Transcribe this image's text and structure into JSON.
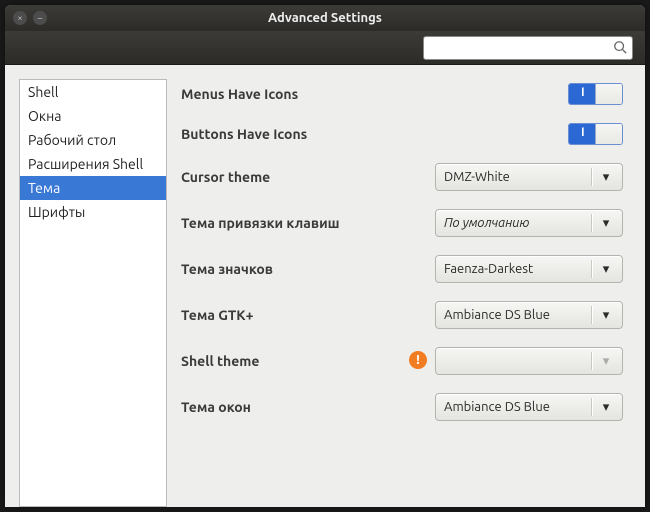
{
  "window": {
    "title": "Advanced Settings"
  },
  "search": {
    "placeholder": ""
  },
  "sidebar": {
    "items": [
      {
        "label": "Shell",
        "selected": false
      },
      {
        "label": "Окна",
        "selected": false
      },
      {
        "label": "Рабочий стол",
        "selected": false
      },
      {
        "label": "Расширения Shell",
        "selected": false
      },
      {
        "label": "Тема",
        "selected": true
      },
      {
        "label": "Шрифты",
        "selected": false
      }
    ]
  },
  "settings": {
    "menus_icons": {
      "label": "Menus Have Icons",
      "value": true
    },
    "buttons_icons": {
      "label": "Buttons Have Icons",
      "value": true
    },
    "cursor_theme": {
      "label": "Cursor theme",
      "value": "DMZ-White"
    },
    "key_theme": {
      "label": "Тема привязки клавиш",
      "value": "По умолчанию"
    },
    "icon_theme": {
      "label": "Тема значков",
      "value": "Faenza-Darkest"
    },
    "gtk_theme": {
      "label": "Тема GTK+",
      "value": "Ambiance DS Blue"
    },
    "shell_theme": {
      "label": "Shell theme",
      "value": "",
      "warning": true
    },
    "window_theme": {
      "label": "Тема окон",
      "value": "Ambiance DS Blue"
    }
  }
}
